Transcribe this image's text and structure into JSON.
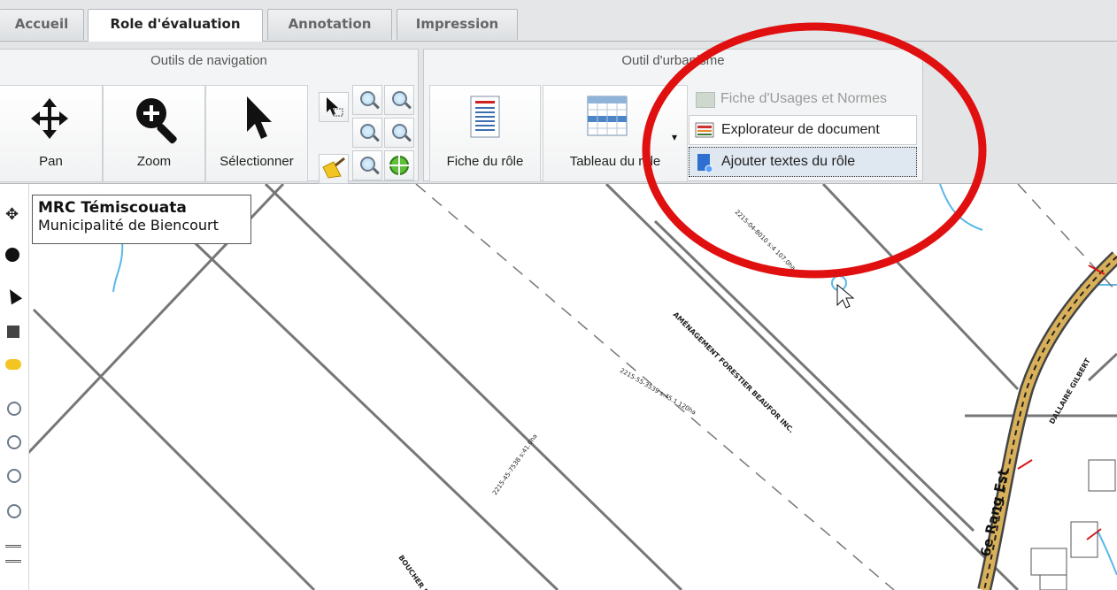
{
  "tabs": [
    {
      "label": "Accueil",
      "active": false
    },
    {
      "label": "Role d'évaluation",
      "active": true
    },
    {
      "label": "Annotation",
      "active": false
    },
    {
      "label": "Impression",
      "active": false
    }
  ],
  "ribbon": {
    "nav_group": {
      "title": "Outils de navigation",
      "pan_label": "Pan",
      "zoom_label": "Zoom",
      "select_label": "Sélectionner"
    },
    "urban_group": {
      "title": "Outil d'urbanisme",
      "fiche_label": "Fiche du rôle",
      "tableau_label": "Tableau du rôle"
    },
    "dropdown_items": [
      {
        "label": "Fiche d'Usages et Normes",
        "enabled": false
      },
      {
        "label": "Explorateur de document",
        "enabled": true
      },
      {
        "label": "Ajouter textes du rôle",
        "enabled": true,
        "highlighted": true
      }
    ]
  },
  "tooltip": {
    "title": "MRC Témiscouata",
    "subtitle": "Municipalité de Biencourt"
  },
  "map": {
    "road_label": "6e Rang Est",
    "labels": [
      "AMÉNAGEMENT FORESTIER BEAUFOR INC.",
      "BOUCHER DANIEL",
      "DALLAIRE GILBERT",
      "2215-04-8010 s:4 107.0ha",
      "2215-55-3539 s:45.1 120ha",
      "2215-45-7538 s:41.0ha"
    ]
  },
  "annotation": {
    "color": "#e01010"
  }
}
